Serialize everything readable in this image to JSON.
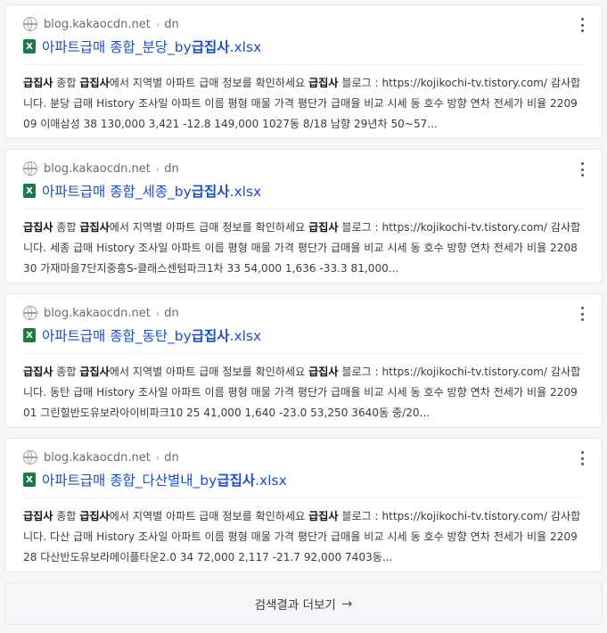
{
  "results": [
    {
      "domain": "blog.kakaocdn.net",
      "path": "dn",
      "file_icon": "excel-icon",
      "file_icon_letter": "X",
      "title_prefix": "아파트급매 종합_분당_by",
      "title_bold": "급집사",
      "title_suffix": ".xlsx",
      "bold_term": "급집사",
      "desc_a": " 종합 ",
      "desc_b": "에서 지역별 아파트 급매 정보를 확인하세요 ",
      "desc_c": " 블로그 : https://kojikochi-tv.tistory.com/ 감사합니다. 분당 급매 History 조사일 아파트 이름 평형 매물 가격 평단가 급매율 비교 시세 동 호수 방향 연차 전세가 비율 220909 이매삼성 38 130,000 3,421 -12.8 149,000 1027동 8/18 남향 29년차 50~57..."
    },
    {
      "domain": "blog.kakaocdn.net",
      "path": "dn",
      "file_icon": "excel-icon",
      "file_icon_letter": "X",
      "title_prefix": "아파트급매 종합_세종_by",
      "title_bold": "급집사",
      "title_suffix": ".xlsx",
      "bold_term": "급집사",
      "desc_a": " 종합 ",
      "desc_b": "에서 지역별 아파트 급매 정보를 확인하세요 ",
      "desc_c": " 블로그 : https://kojikochi-tv.tistory.com/ 감사합니다. 세종 급매 History 조사일 아파트 이름 평형 매물 가격 평단가 급매율 비교 시세 동 호수 방향 연차 전세가 비율 220830 가재마을7단지중흥S-클래스센텀파크1차 33 54,000 1,636 -33.3 81,000..."
    },
    {
      "domain": "blog.kakaocdn.net",
      "path": "dn",
      "file_icon": "excel-icon",
      "file_icon_letter": "X",
      "title_prefix": "아파트급매 종합_동탄_by",
      "title_bold": "급집사",
      "title_suffix": ".xlsx",
      "bold_term": "급집사",
      "desc_a": " 종합 ",
      "desc_b": "에서 지역별 아파트 급매 정보를 확인하세요 ",
      "desc_c": " 블로그 : https://kojikochi-tv.tistory.com/ 감사합니다. 동탄 급매 History 조사일 아파트 이름 평형 매물 가격 평단가 급매율 비교 시세 동 호수 방향 연차 전세가 비율 220901 그린힐반도유보라아이비파크10 25 41,000 1,640 -23.0 53,250 3640동 중/20..."
    },
    {
      "domain": "blog.kakaocdn.net",
      "path": "dn",
      "file_icon": "excel-icon",
      "file_icon_letter": "X",
      "title_prefix": "아파트급매 종합_다산별내_by",
      "title_bold": "급집사",
      "title_suffix": ".xlsx",
      "bold_term": "급집사",
      "desc_a": " 종합 ",
      "desc_b": "에서 지역별 아파트 급매 정보를 확인하세요 ",
      "desc_c": " 블로그 : https://kojikochi-tv.tistory.com/ 감사합니다. 다산 급매 History 조사일 아파트 이름 평형 매물 가격 평단가 급매율 비교 시세 동 호수 방향 연차 전세가 비율 220928 다산반도유보라메이플타운2.0 34 72,000 2,117 -21.7 92,000 7403동..."
    }
  ],
  "more_results": {
    "label": "검색결과 더보기",
    "arrow": "→"
  },
  "colors": {
    "link": "#1a4dc6",
    "excel": "#1d7a45",
    "background": "#f5f6f8"
  }
}
